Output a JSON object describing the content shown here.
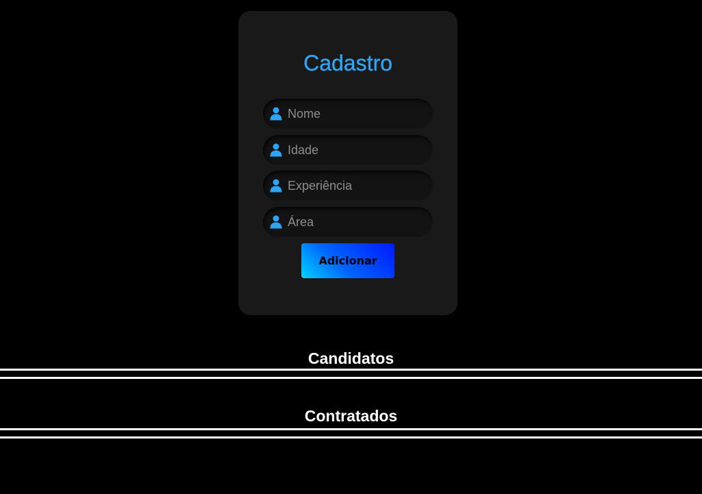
{
  "form": {
    "title": "Cadastro",
    "fields": [
      {
        "placeholder": "Nome",
        "icon": "user-icon"
      },
      {
        "placeholder": "Idade",
        "icon": "user-icon"
      },
      {
        "placeholder": "Experiência",
        "icon": "user-icon"
      },
      {
        "placeholder": "Área",
        "icon": "user-icon"
      }
    ],
    "submit_label": "Adicionar"
  },
  "sections": {
    "candidates_title": "Candidatos",
    "hired_title": "Contratados"
  },
  "colors": {
    "background": "#000000",
    "card": "#191919",
    "accent": "#2fa4f5",
    "button_gradient_start": "#00d4ff",
    "button_gradient_end": "#0018ff"
  }
}
